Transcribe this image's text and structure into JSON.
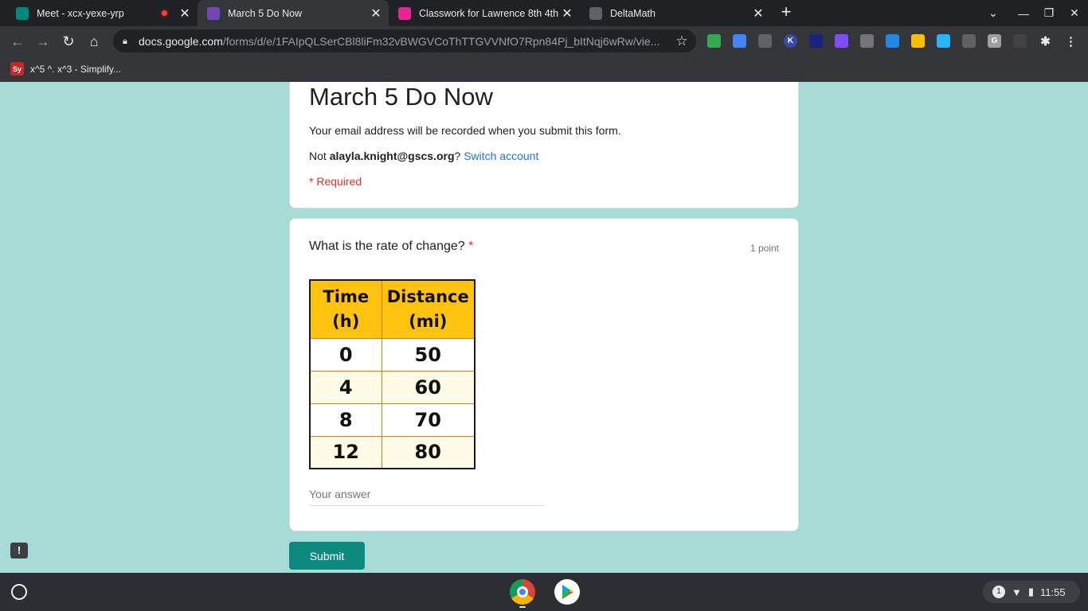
{
  "browser": {
    "tabs": [
      {
        "title": "Meet - xcx-yexe-yrp",
        "recording": true,
        "color": "#00897b"
      },
      {
        "title": "March 5 Do Now",
        "active": true,
        "color": "#7248b9"
      },
      {
        "title": "Classwork for Lawrence 8th 4th",
        "color": "#e52592"
      },
      {
        "title": "DeltaMath",
        "color": "#5f6368"
      }
    ],
    "new_tab_label": "+",
    "url_host": "docs.google.com",
    "url_path": "/forms/d/e/1FAIpQLSerCBl8liFm32vBWGVCoThTTGVVNfO7Rpn84Pj_bItNqj6wRw/vie...",
    "bookmark": {
      "icon_text": "Sy",
      "label": "x^5 ^. x^3 - Simplify..."
    }
  },
  "form": {
    "title": "March 5 Do Now",
    "email_notice": "Your email address will be recorded when you submit this form.",
    "not_prefix": "Not ",
    "account_email": "alayla.knight@gscs.org",
    "not_suffix": "?",
    "switch_account": "Switch account",
    "required_note": "* Required",
    "question": {
      "text": "What is the rate of change?",
      "required_star": "*",
      "points": "1 point",
      "answer_placeholder": "Your answer"
    },
    "submit_label": "Submit"
  },
  "table_image": {
    "headers": [
      [
        "Time",
        "(h)"
      ],
      [
        "Distance",
        "(mi)"
      ]
    ],
    "rows": [
      [
        "0",
        "50"
      ],
      [
        "4",
        "60"
      ],
      [
        "8",
        "70"
      ],
      [
        "12",
        "80"
      ]
    ]
  },
  "shelf": {
    "notification_count": "1",
    "time": "11:55"
  },
  "colors": {
    "page_bg": "#a6dbd6",
    "submit_bg": "#0d8a7d",
    "table_header": "#ffc20e"
  }
}
